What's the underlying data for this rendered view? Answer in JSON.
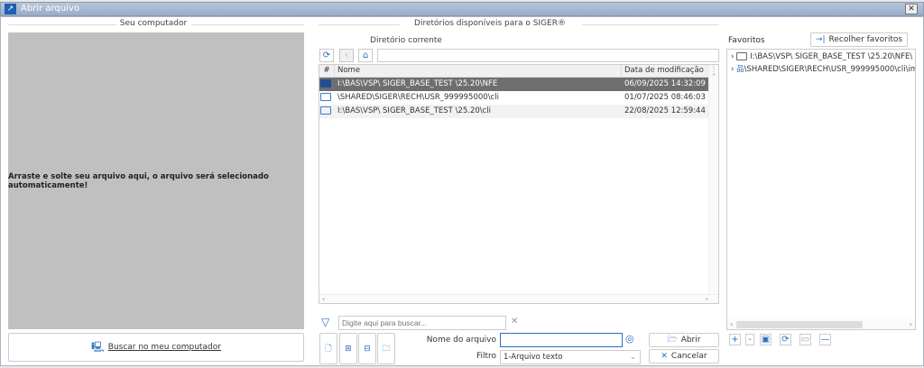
{
  "window": {
    "title": "Abrir arquivo",
    "close": "✕"
  },
  "left": {
    "section_title": "Seu computador",
    "drop_text": "Arraste e solte seu arquivo aqui, o arquivo será selecionado automaticamente!",
    "browse_button": "Buscar no meu computador"
  },
  "middle": {
    "section_title": "Diretórios disponíveis para o SIGER®",
    "current_dir_label": "Diretório corrente",
    "path_value": "",
    "columns": {
      "index": "#",
      "name": "Nome",
      "date": "Data de modificação"
    },
    "rows": [
      {
        "name": "I:\\BAS\\VSP\\ SIGER_BASE_TEST \\25.20\\NFE",
        "date": "06/09/2025 14:32:09",
        "selected": true
      },
      {
        "name": "\\SHARED\\SIGER\\RECH\\USR_999995000\\cli",
        "date": "01/07/2025 08:46:03",
        "selected": false
      },
      {
        "name": "I:\\BAS\\VSP\\ SIGER_BASE_TEST \\25.20\\cli",
        "date": "22/08/2025 12:59:44",
        "selected": false
      }
    ],
    "search_placeholder": "Digite aqui para buscar...",
    "filename_label": "Nome do arquivo",
    "filename_value": "",
    "filter_label": "Filtro",
    "filter_value": "1-Arquivo texto",
    "open_button": "Abrir",
    "cancel_button": "Cancelar"
  },
  "right": {
    "favorites_label": "Favoritos",
    "collapse_button": "Recolher favoritos",
    "items": [
      {
        "path": "I:\\BAS\\VSP\\ SIGER_BASE_TEST \\25.20\\NFE\\"
      },
      {
        "path": "\\SHARED\\SIGER\\RECH\\USR_999995000\\cli\\im"
      }
    ]
  }
}
